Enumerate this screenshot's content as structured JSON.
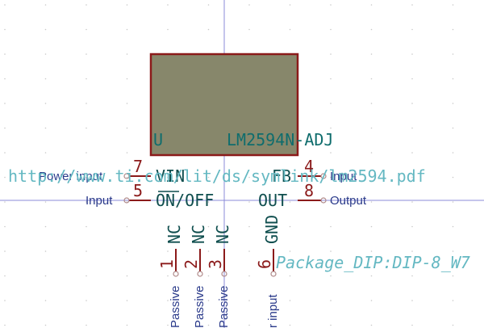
{
  "component": {
    "reference": "U",
    "value": "LM2594N-ADJ",
    "datasheet": "http://www.ti.com/lit/ds/symlink/lm2594.pdf",
    "footprint": "Package_DIP:DIP-8_W7"
  },
  "pins": {
    "p7": {
      "number": "7",
      "name": "VIN",
      "type": "Power input"
    },
    "p5": {
      "number": "5",
      "name": "ON/OFF",
      "type": "Input"
    },
    "p4": {
      "number": "4",
      "name": "FB",
      "type": "Input"
    },
    "p8": {
      "number": "8",
      "name": "OUT",
      "type": "Output"
    },
    "p1": {
      "number": "1",
      "name": "NC",
      "type": "Passive"
    },
    "p2": {
      "number": "2",
      "name": "NC",
      "type": "Passive"
    },
    "p3": {
      "number": "3",
      "name": "NC",
      "type": "Passive"
    },
    "p6": {
      "number": "6",
      "name": "GND",
      "type": "r input"
    }
  },
  "colors": {
    "body_fill": "#87876b",
    "body_stroke": "#8b1a1a",
    "pin_line": "#8b1a1a",
    "crosshair": "#8b8bd8"
  }
}
